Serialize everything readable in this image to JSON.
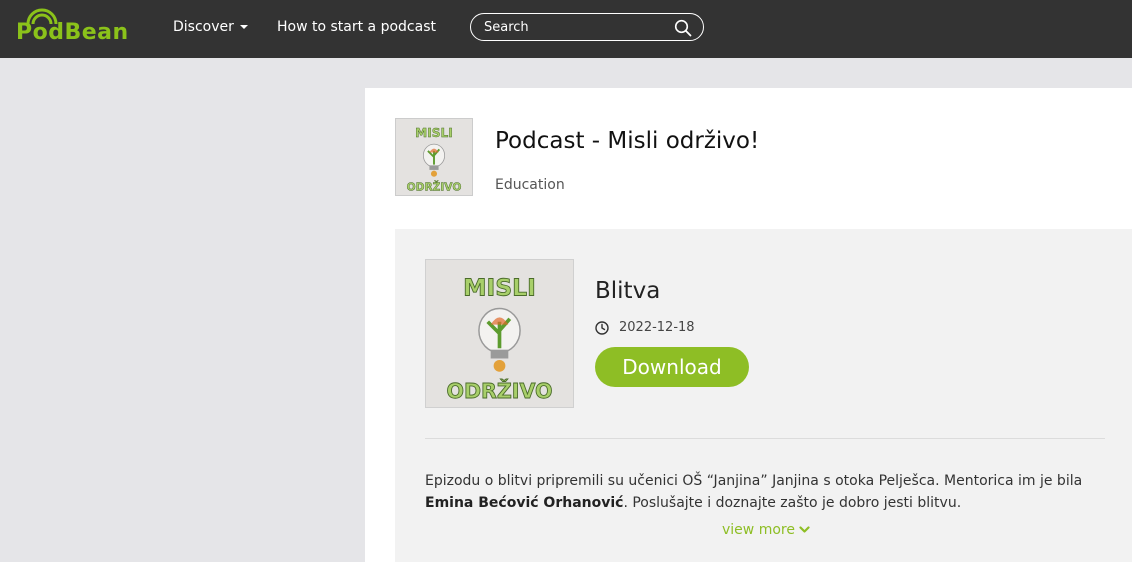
{
  "header": {
    "logo_text": "PodBean",
    "nav": {
      "discover_label": "Discover",
      "howto_label": "How to start a podcast"
    },
    "search": {
      "placeholder": "Search",
      "icon": "search-icon"
    }
  },
  "podcast": {
    "title": "Podcast - Misli održivo!",
    "category": "Education",
    "thumb_text_top": "MISLI",
    "thumb_text_bottom": "ODRŽIVO"
  },
  "episode": {
    "title": "Blitva",
    "date": "2022-12-18",
    "download_label": "Download",
    "thumb_text_top": "MISLI",
    "thumb_text_bottom": "ODRŽIVO",
    "description_part1": "Epizodu o blitvi pripremili su učenici OŠ “Janjina” Janjina s otoka Pelješca. Mentorica im je bila ",
    "description_bold": "Emina Bećović Orhanović",
    "description_part2": ". Poslušajte i doznajte zašto je dobro jesti blitvu.",
    "view_more_label": "view more"
  },
  "colors": {
    "accent": "#8ebe25",
    "header_bg": "#333333",
    "page_bg": "#e5e5e8"
  }
}
